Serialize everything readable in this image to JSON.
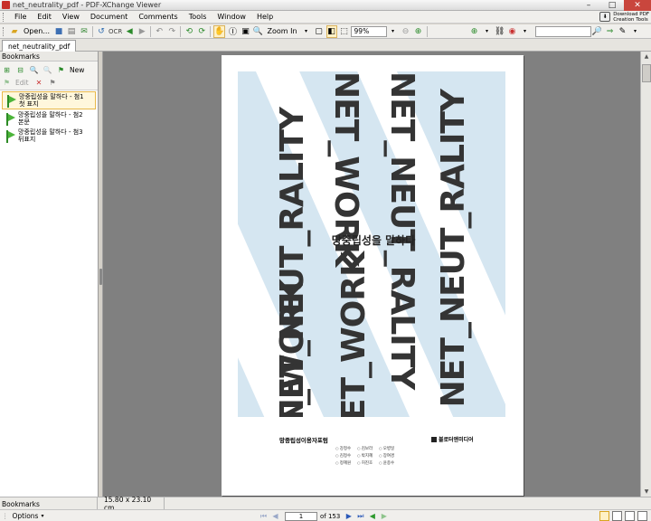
{
  "window": {
    "title": "net_neutrality_pdf - PDF-XChange Viewer"
  },
  "menu": [
    "File",
    "Edit",
    "View",
    "Document",
    "Comments",
    "Tools",
    "Window",
    "Help"
  ],
  "download_promo": {
    "line1": "Download PDF",
    "line2": "Creation Tools"
  },
  "toolbar": {
    "open_label": "Open...",
    "zoom_in_label": "Zoom In",
    "zoom_value": "99%"
  },
  "tab": {
    "name": "net_neutrality_pdf"
  },
  "bookmarks_panel": {
    "header": "Bookmarks",
    "new_label": "New",
    "edit_label": "Edit",
    "items": [
      {
        "label": "망중립성을 말하다 - 첨1 첫 표지",
        "selected": true
      },
      {
        "label": "망중립성을 말하다 - 첨2 본문",
        "selected": false
      },
      {
        "label": "망중립성을 말하다 - 첨3 뒤표지",
        "selected": false
      }
    ]
  },
  "page": {
    "book_title": "망중립성을 말하다",
    "cover_columns": [
      "NET_NEUT_RALITY",
      "NET_WORK",
      "NET_NEUT_RALITY",
      "NET_NEUT_RALITY",
      "NET_WORK",
      "NET_WORK"
    ],
    "organization": "망중립성이용자포럼",
    "publisher": "블로터앤미디어",
    "authors": [
      "강정수",
      "김보라",
      "오병일",
      "김정수",
      "박지혜",
      "장여경",
      "정혜원",
      "허진호",
      "윤종수"
    ]
  },
  "status": {
    "bookmarks_tab": "Bookmarks",
    "page_size": "15.80 x 23.10 cm"
  },
  "nav": {
    "options_label": "Options",
    "current_page": "1",
    "of_label": "of 153"
  }
}
